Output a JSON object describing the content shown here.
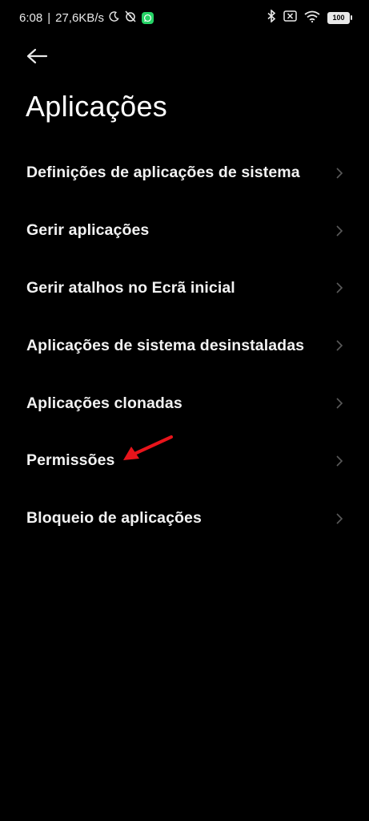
{
  "status_bar": {
    "time": "6:08",
    "separator": "|",
    "network_speed": "27,6KB/s",
    "battery_level": "100",
    "icons": [
      "moon-icon",
      "alarm-off-icon",
      "whatsapp-icon",
      "bluetooth-icon",
      "no-sim-icon",
      "wifi-icon",
      "battery-icon"
    ]
  },
  "header": {
    "title": "Aplicações"
  },
  "menu": {
    "items": [
      {
        "label": "Definições de aplicações de sistema"
      },
      {
        "label": "Gerir aplicações"
      },
      {
        "label": "Gerir atalhos no Ecrã inicial"
      },
      {
        "label": "Aplicações de sistema desinstaladas"
      },
      {
        "label": "Aplicações clonadas"
      },
      {
        "label": "Permissões"
      },
      {
        "label": "Bloqueio de aplicações"
      }
    ]
  },
  "colors": {
    "background": "#000000",
    "text": "#ffffff",
    "chevron": "#5a5a5a",
    "annotation": "#e8141b",
    "whatsapp": "#25d366"
  }
}
